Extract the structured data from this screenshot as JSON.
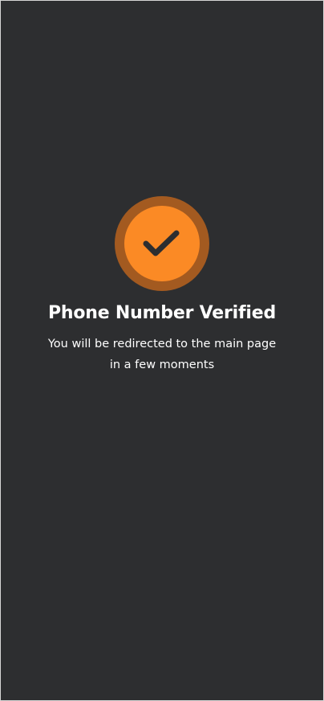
{
  "colors": {
    "background": "#2d2e30",
    "accent": "#fb8a25",
    "accent_ring": "#a35a20",
    "check": "#2d2e30",
    "text": "#ffffff"
  },
  "status": {
    "icon": "check-icon",
    "title": "Phone Number Verified",
    "message": "You will be redirected to the main page in a few moments"
  }
}
